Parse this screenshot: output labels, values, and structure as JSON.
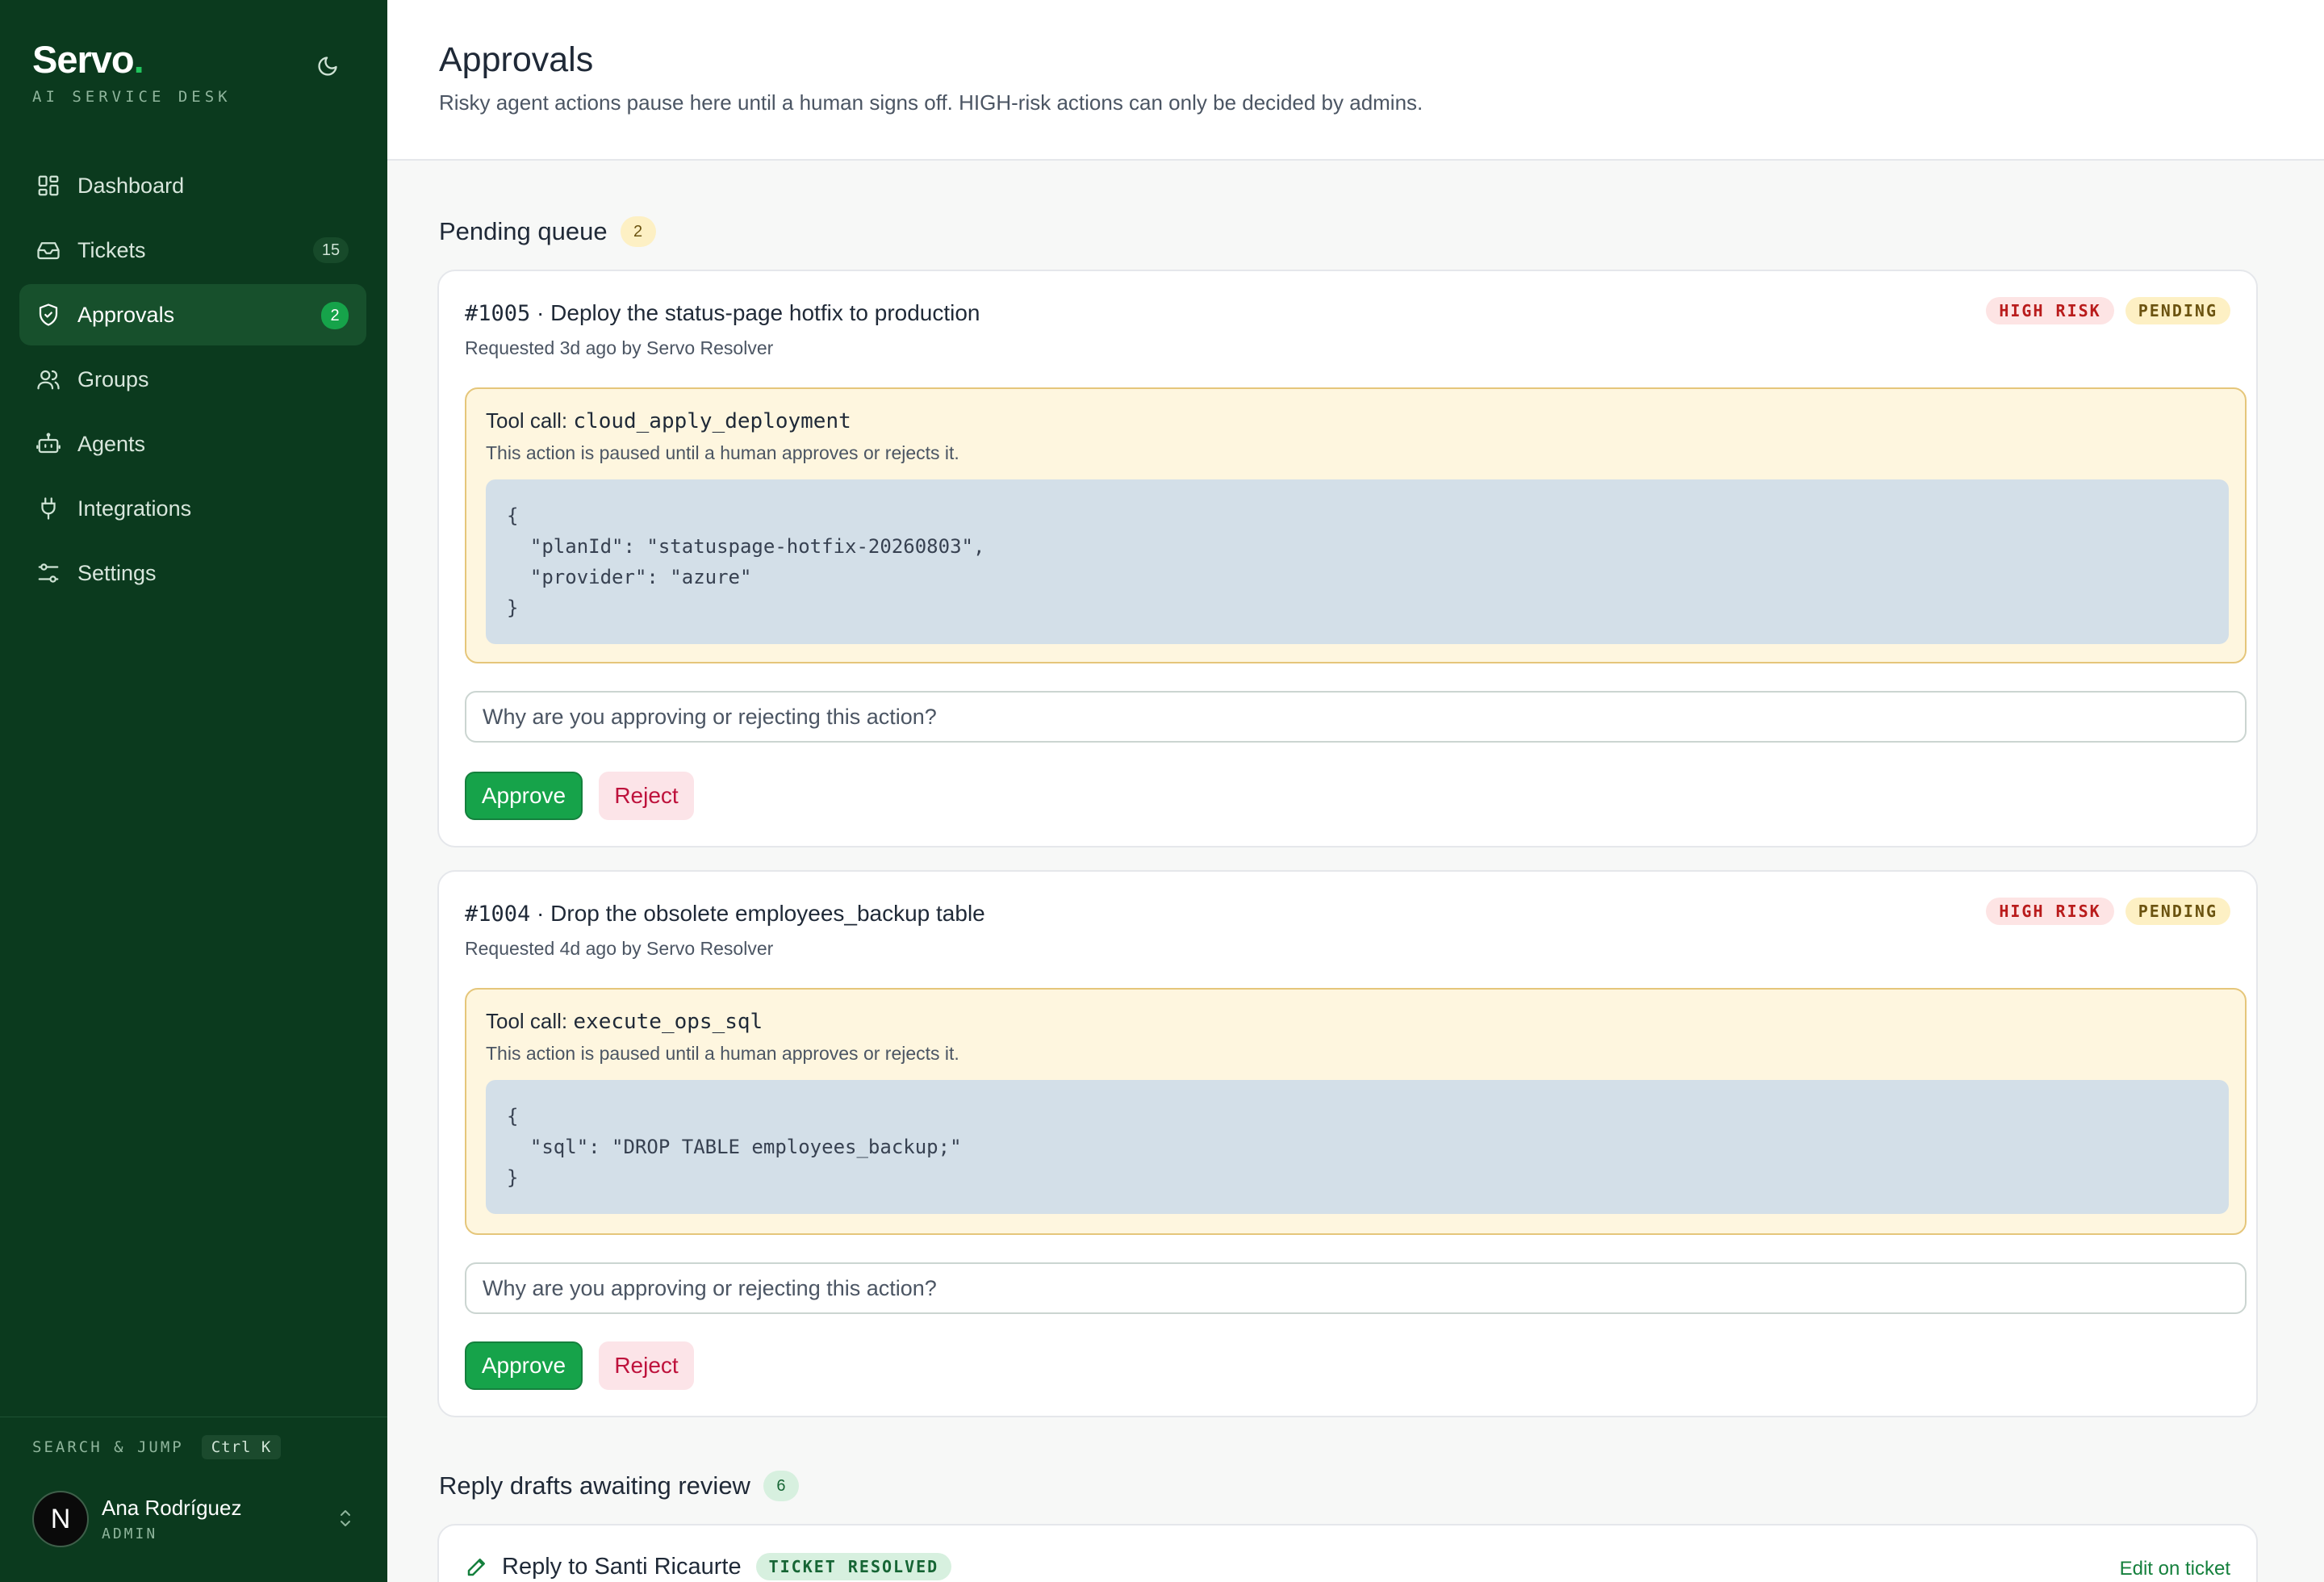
{
  "brand": {
    "name": "Servo",
    "dot": ".",
    "subtitle": "AI SERVICE DESK"
  },
  "sidebar": {
    "items": [
      {
        "label": "Dashboard",
        "icon": "dashboard-icon"
      },
      {
        "label": "Tickets",
        "icon": "inbox-icon",
        "count": "15"
      },
      {
        "label": "Approvals",
        "icon": "shield-check-icon",
        "count": "2",
        "active": true
      },
      {
        "label": "Groups",
        "icon": "users-icon"
      },
      {
        "label": "Agents",
        "icon": "bot-icon"
      },
      {
        "label": "Integrations",
        "icon": "plug-icon"
      },
      {
        "label": "Settings",
        "icon": "sliders-icon"
      }
    ],
    "search_label": "SEARCH & JUMP",
    "shortcut": "Ctrl K",
    "user": {
      "initial": "N",
      "name": "Ana Rodríguez",
      "role": "ADMIN"
    }
  },
  "header": {
    "title": "Approvals",
    "subtitle": "Risky agent actions pause here until a human signs off. HIGH-risk actions can only be decided by admins."
  },
  "pending": {
    "title": "Pending queue",
    "count": "2",
    "cards": [
      {
        "number": "#1005",
        "separator": " · ",
        "title": "Deploy the status-page hotfix to production",
        "meta": "Requested 3d ago by Servo Resolver",
        "risk": "HIGH RISK",
        "status": "PENDING",
        "tool_prefix": "Tool call: ",
        "tool_name": "cloud_apply_deployment",
        "tool_note": "This action is paused until a human approves or rejects it.",
        "code": "{\n  \"planId\": \"statuspage-hotfix-20260803\",\n  \"provider\": \"azure\"\n}",
        "reason_placeholder": "Why are you approving or rejecting this action?",
        "approve": "Approve",
        "reject": "Reject"
      },
      {
        "number": "#1004",
        "separator": " · ",
        "title": "Drop the obsolete employees_backup table",
        "meta": "Requested 4d ago by Servo Resolver",
        "risk": "HIGH RISK",
        "status": "PENDING",
        "tool_prefix": "Tool call: ",
        "tool_name": "execute_ops_sql",
        "tool_note": "This action is paused until a human approves or rejects it.",
        "code": "{\n  \"sql\": \"DROP TABLE employees_backup;\"\n}",
        "reason_placeholder": "Why are you approving or rejecting this action?",
        "approve": "Approve",
        "reject": "Reject"
      }
    ]
  },
  "drafts": {
    "title": "Reply drafts awaiting review",
    "count": "6",
    "items": [
      {
        "title": "Reply to Santi Ricaurte",
        "tag": "TICKET RESOLVED",
        "edit": "Edit on ticket"
      }
    ]
  },
  "colors": {
    "sidebar": "#0b3a1e",
    "accent": "#16a34a",
    "risk": "#b91c1c",
    "pending": "#6b5310"
  }
}
